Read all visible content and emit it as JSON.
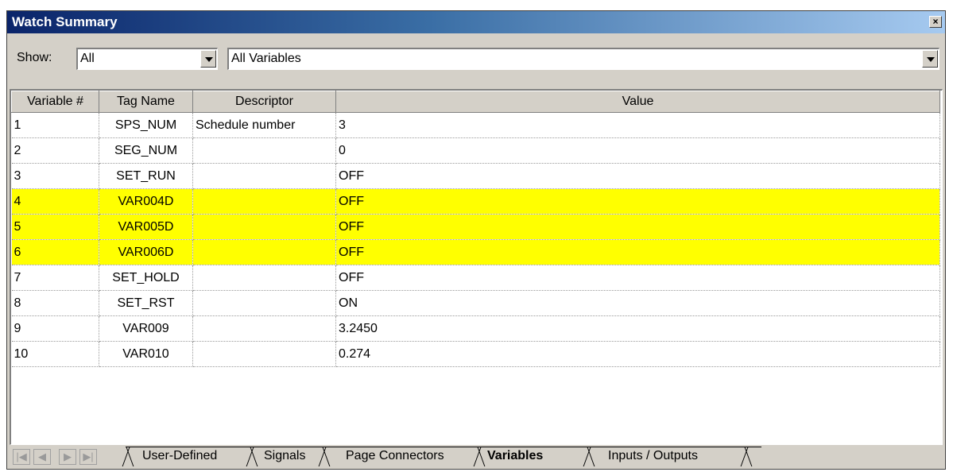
{
  "window": {
    "title": "Watch Summary",
    "close_glyph": "×"
  },
  "filter": {
    "show_label": "Show:",
    "show_value": "All",
    "scope_value": "All Variables"
  },
  "table": {
    "columns": [
      "Variable #",
      "Tag Name",
      "Descriptor",
      "Value"
    ],
    "rows": [
      {
        "num": "1",
        "tag": "SPS_NUM",
        "descriptor": "Schedule number",
        "value": "3",
        "highlight": false
      },
      {
        "num": "2",
        "tag": "SEG_NUM",
        "descriptor": "",
        "value": "0",
        "highlight": false
      },
      {
        "num": "3",
        "tag": "SET_RUN",
        "descriptor": "",
        "value": "OFF",
        "highlight": false
      },
      {
        "num": "4",
        "tag": "VAR004D",
        "descriptor": "",
        "value": "OFF",
        "highlight": true
      },
      {
        "num": "5",
        "tag": "VAR005D",
        "descriptor": "",
        "value": "OFF",
        "highlight": true
      },
      {
        "num": "6",
        "tag": "VAR006D",
        "descriptor": "",
        "value": "OFF",
        "highlight": true
      },
      {
        "num": "7",
        "tag": "SET_HOLD",
        "descriptor": "",
        "value": "OFF",
        "highlight": false
      },
      {
        "num": "8",
        "tag": "SET_RST",
        "descriptor": "",
        "value": "ON",
        "highlight": false
      },
      {
        "num": "9",
        "tag": "VAR009",
        "descriptor": "",
        "value": "3.2450",
        "highlight": false
      },
      {
        "num": "10",
        "tag": "VAR010",
        "descriptor": "",
        "value": "0.274",
        "highlight": false
      }
    ]
  },
  "tabs": {
    "nav_icons": [
      "first-icon",
      "prev-icon",
      "next-icon",
      "last-icon"
    ],
    "items": [
      "User-Defined",
      "Signals",
      "Page Connectors",
      "Variables",
      "Inputs / Outputs"
    ],
    "active": "Variables"
  },
  "colors": {
    "highlight": "#ffff00",
    "title_start": "#0a246a",
    "title_end": "#a6caf0"
  }
}
